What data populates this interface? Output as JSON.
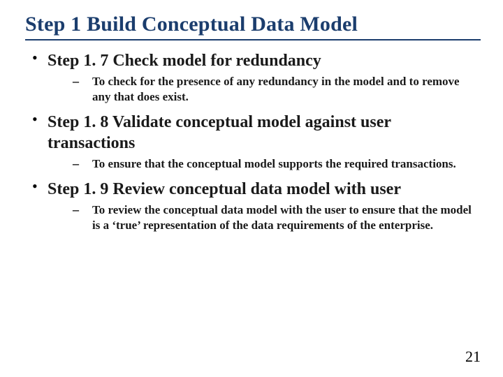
{
  "title": "Step 1 Build Conceptual Data Model",
  "items": [
    {
      "heading": "Step 1. 7  Check model for redundancy",
      "detail": "To check for the presence of any redundancy in the model and to remove any that does exist."
    },
    {
      "heading": "Step 1. 8  Validate conceptual model against user transactions",
      "detail": "To ensure that the conceptual model supports the required transactions."
    },
    {
      "heading": "Step 1. 9  Review conceptual data model with user",
      "detail": "To review the conceptual data model with the user to ensure that the model is a ‘true’ representation of the data requirements of the enterprise."
    }
  ],
  "page_number": "21"
}
